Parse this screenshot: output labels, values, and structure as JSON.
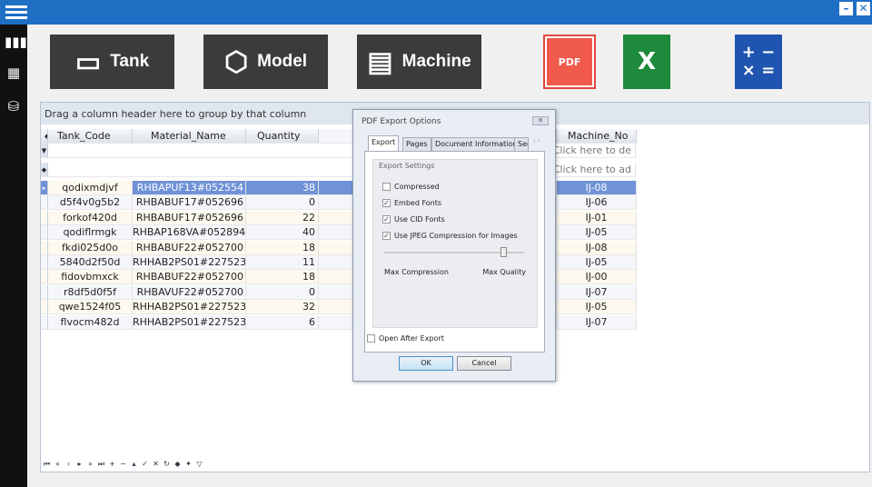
{
  "toolbar": {
    "tank": "Tank",
    "model": "Model",
    "machine": "Machine",
    "pdf_label": "PDF",
    "excel_label": "X"
  },
  "grid": {
    "group_hint": "Drag a column header here to group by that column",
    "columns": [
      "Tank_Code",
      "Material_Name",
      "Quantity",
      "Machine_No"
    ],
    "filter_hint": "Click here to de",
    "new_row_hint": "Click here to ad",
    "rows": [
      [
        "qodixmdjvf",
        "RHBAPUF13#052554",
        "38",
        "IJ-08"
      ],
      [
        "d5f4v0g5b2",
        "RHBABUF17#052696",
        "0",
        "IJ-06"
      ],
      [
        "forkof420d",
        "RHBABUF17#052696",
        "22",
        "IJ-01"
      ],
      [
        "qodiflrmgk",
        "RHBAP168VA#052894",
        "40",
        "IJ-05"
      ],
      [
        "fkdi025d0o",
        "RHBABUF22#052700",
        "18",
        "IJ-08"
      ],
      [
        "5840d2f50d",
        "RHHAB2PS01#227523",
        "11",
        "IJ-05"
      ],
      [
        "fidovbmxck",
        "RHBABUF22#052700",
        "18",
        "IJ-00"
      ],
      [
        "r8df5d0f5f",
        "RHBAVUF22#052700",
        "0",
        "IJ-07"
      ],
      [
        "qwe1524f05",
        "RHHAB2PS01#227523",
        "32",
        "IJ-05"
      ],
      [
        "flvocm482d",
        "RHHAB2PS01#227523",
        "6",
        "IJ-07"
      ]
    ]
  },
  "dialog": {
    "title": "PDF Export Options",
    "tabs": [
      "Export",
      "Pages",
      "Document Information",
      "Sec"
    ],
    "group": "Export Settings",
    "options": [
      {
        "label": "Compressed",
        "checked": false
      },
      {
        "label": "Embed Fonts",
        "checked": true
      },
      {
        "label": "Use CID Fonts",
        "checked": true
      },
      {
        "label": "Use JPEG Compression for Images",
        "checked": true
      }
    ],
    "slider_min": "Max Compression",
    "slider_max": "Max Quality",
    "slider_value": 0.85,
    "open_after": "Open After Export",
    "ok": "OK",
    "cancel": "Cancel"
  }
}
